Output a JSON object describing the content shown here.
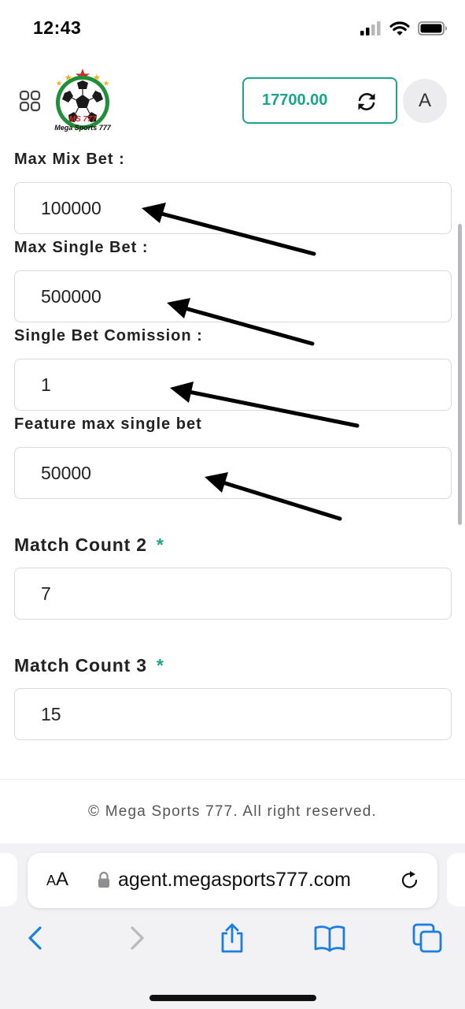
{
  "status_bar": {
    "time": "12:43",
    "icons": [
      "cellular-signal-icon",
      "wifi-icon",
      "battery-icon"
    ]
  },
  "header": {
    "menu_icon": "grid-menu-icon",
    "logo_text_ms": "MS 777",
    "logo_text_name": "Mega Sports 777",
    "balance": "17700.00",
    "refresh_icon": "refresh-icon",
    "avatar_letter": "A"
  },
  "form": {
    "max_mix_bet": {
      "label": "Max Mix Bet :",
      "value": "100000"
    },
    "max_single_bet": {
      "label": "Max Single Bet :",
      "value": "500000"
    },
    "single_bet_commission": {
      "label": "Single Bet Comission :",
      "value": "1"
    },
    "feature_max_single_bet": {
      "label": "Feature max single bet",
      "value": "50000"
    },
    "match_count_2": {
      "label": "Match Count 2",
      "required": "*",
      "value": "7"
    },
    "match_count_3": {
      "label": "Match Count 3",
      "required": "*",
      "value": "15"
    }
  },
  "footer": {
    "copyright": "© Mega Sports 777. All right reserved."
  },
  "browser": {
    "text_size_label_small": "A",
    "text_size_label_big": "A",
    "url": "agent.megasports777.com",
    "toolbar": [
      "back-icon",
      "forward-icon",
      "share-icon",
      "bookmarks-icon",
      "tabs-icon"
    ]
  },
  "colors": {
    "accent": "#1aa58c",
    "label": "#222222",
    "input_border": "#d9d9de"
  }
}
